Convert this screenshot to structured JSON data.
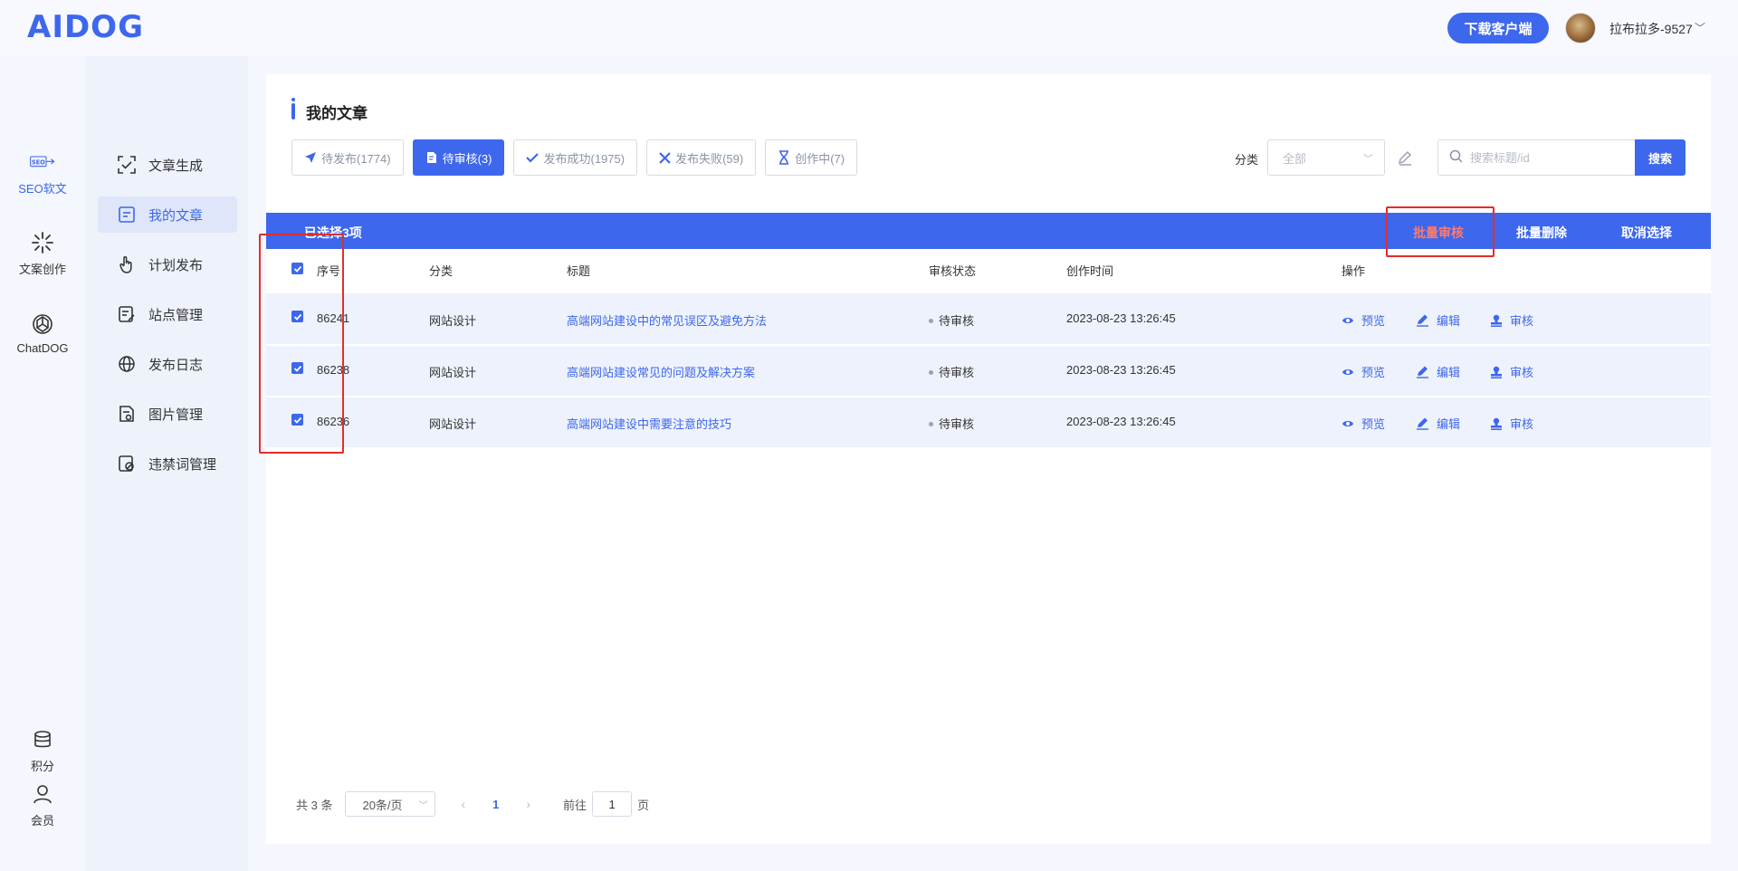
{
  "brand": {
    "logo_text": "AIDOG"
  },
  "header": {
    "download_label": "下载客户端",
    "username": "拉布拉多-9527"
  },
  "rail": {
    "items": [
      {
        "label": "SEO软文",
        "icon": "seo-icon"
      },
      {
        "label": "文案创作",
        "icon": "sparkle-icon"
      },
      {
        "label": "ChatDOG",
        "icon": "openai-icon"
      },
      {
        "label": "积分",
        "icon": "coins-icon"
      },
      {
        "label": "会员",
        "icon": "user-icon"
      }
    ]
  },
  "sidebar": {
    "items": [
      {
        "label": "文章生成",
        "icon": "scan-icon"
      },
      {
        "label": "我的文章",
        "icon": "article-icon"
      },
      {
        "label": "计划发布",
        "icon": "hand-icon"
      },
      {
        "label": "站点管理",
        "icon": "site-icon"
      },
      {
        "label": "发布日志",
        "icon": "globe-icon"
      },
      {
        "label": "图片管理",
        "icon": "image-icon"
      },
      {
        "label": "违禁词管理",
        "icon": "forbidden-icon"
      }
    ]
  },
  "main": {
    "title": "我的文章",
    "tabs": [
      {
        "label": "待发布(1774)",
        "icon": "send-icon"
      },
      {
        "label": "待审核(3)",
        "icon": "review-doc-icon"
      },
      {
        "label": "发布成功(1975)",
        "icon": "check-icon"
      },
      {
        "label": "发布失败(59)",
        "icon": "x-icon"
      },
      {
        "label": "创作中(7)",
        "icon": "hourglass-icon"
      }
    ],
    "filter": {
      "label": "分类",
      "value": "全部"
    },
    "search": {
      "placeholder": "搜索标题/id",
      "button": "搜索"
    }
  },
  "selection": {
    "count_label": "已选择3项",
    "actions": [
      "批量审核",
      "批量删除",
      "取消选择"
    ]
  },
  "table": {
    "columns": [
      "序号",
      "分类",
      "标题",
      "审核状态",
      "创作时间",
      "操作"
    ],
    "rows": [
      {
        "id": "86241",
        "category": "网站设计",
        "title": "高端网站建设中的常见误区及避免方法",
        "status": "待审核",
        "time": "2023-08-23 13:26:45"
      },
      {
        "id": "86238",
        "category": "网站设计",
        "title": "高端网站建设常见的问题及解决方案",
        "status": "待审核",
        "time": "2023-08-23 13:26:45"
      },
      {
        "id": "86236",
        "category": "网站设计",
        "title": "高端网站建设中需要注意的技巧",
        "status": "待审核",
        "time": "2023-08-23 13:26:45"
      }
    ],
    "row_actions": [
      "预览",
      "编辑",
      "审核"
    ]
  },
  "pagination": {
    "total": "共 3 条",
    "page_size": "20条/页",
    "current_page": "1",
    "goto_label": "前往",
    "goto_value": "1",
    "page_suffix": "页"
  },
  "colors": {
    "accent": "#3d67ec",
    "highlight": "#ff7a6a",
    "annotation": "#e32d2d"
  }
}
